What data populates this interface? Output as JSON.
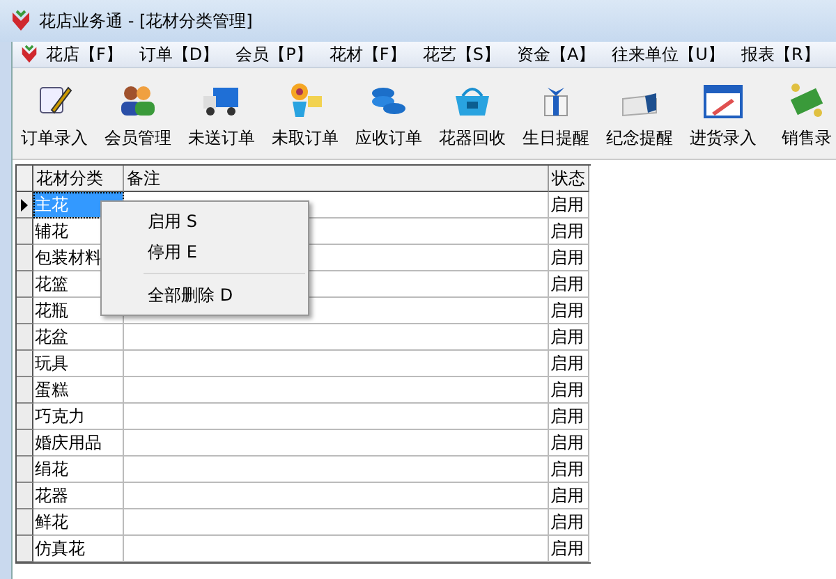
{
  "window": {
    "title": "花店业务通 - [花材分类管理]"
  },
  "menu": [
    "花店【F】",
    "订单【D】",
    "会员【P】",
    "花材【F】",
    "花艺【S】",
    "资金【A】",
    "往来单位【U】",
    "报表【R】"
  ],
  "toolbar": [
    {
      "label": "订单录入",
      "kind": "pen"
    },
    {
      "label": "会员管理",
      "kind": "people"
    },
    {
      "label": "未送订单",
      "kind": "truck"
    },
    {
      "label": "未取订单",
      "kind": "flower"
    },
    {
      "label": "应收订单",
      "kind": "coins"
    },
    {
      "label": "花器回收",
      "kind": "basket"
    },
    {
      "label": "生日提醒",
      "kind": "gift"
    },
    {
      "label": "纪念提醒",
      "kind": "box"
    },
    {
      "label": "进货录入",
      "kind": "document"
    },
    {
      "label": "销售录",
      "kind": "money"
    }
  ],
  "table": {
    "columns": [
      "花材分类",
      "备注",
      "状态"
    ],
    "rows": [
      {
        "category": "主花",
        "status": "启用",
        "selected": true
      },
      {
        "category": "辅花",
        "status": "启用",
        "selected": false
      },
      {
        "category": "包装材料",
        "status": "启用",
        "selected": false
      },
      {
        "category": "花篮",
        "status": "启用",
        "selected": false
      },
      {
        "category": "花瓶",
        "status": "启用",
        "selected": false
      },
      {
        "category": "花盆",
        "status": "启用",
        "selected": false
      },
      {
        "category": "玩具",
        "status": "启用",
        "selected": false
      },
      {
        "category": "蛋糕",
        "status": "启用",
        "selected": false
      },
      {
        "category": "巧克力",
        "status": "启用",
        "selected": false
      },
      {
        "category": "婚庆用品",
        "status": "启用",
        "selected": false
      },
      {
        "category": "绢花",
        "status": "启用",
        "selected": false
      },
      {
        "category": "花器",
        "status": "启用",
        "selected": false
      },
      {
        "category": "鲜花",
        "status": "启用",
        "selected": false
      },
      {
        "category": "仿真花",
        "status": "启用",
        "selected": false
      }
    ]
  },
  "context_menu": [
    {
      "label": "启用 S",
      "kind": "item"
    },
    {
      "label": "停用 E",
      "kind": "item"
    },
    {
      "kind": "separator"
    },
    {
      "label": "全部删除 D",
      "kind": "item"
    }
  ]
}
